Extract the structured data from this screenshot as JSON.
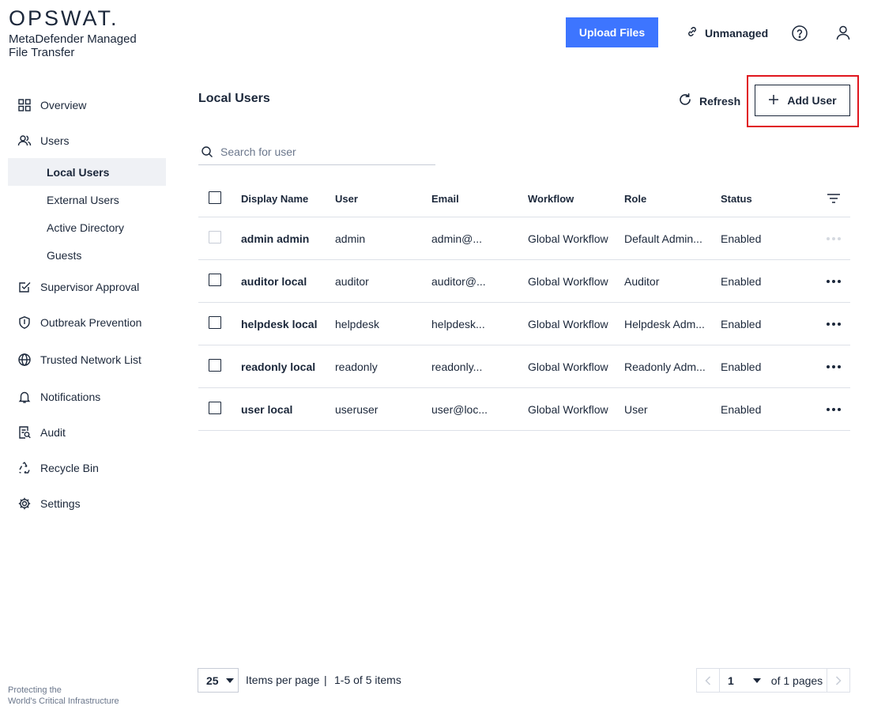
{
  "brand": {
    "wordmark": "OPSWAT.",
    "product_line1": "MetaDefender Managed",
    "product_line2": "File Transfer",
    "footer_line1": "Protecting the",
    "footer_line2": "World's Critical Infrastructure"
  },
  "header": {
    "upload_label": "Upload Files",
    "unmanaged_label": "Unmanaged",
    "help_icon": "help-circle-icon",
    "user_icon": "user-icon"
  },
  "sidebar": {
    "overview": "Overview",
    "users": "Users",
    "users_sub": {
      "local_users": "Local Users",
      "external_users": "External Users",
      "active_directory": "Active Directory",
      "guests": "Guests"
    },
    "supervisor_approval": "Supervisor Approval",
    "outbreak_prevention": "Outbreak Prevention",
    "trusted_network_list": "Trusted Network List",
    "notifications": "Notifications",
    "audit": "Audit",
    "recycle_bin": "Recycle Bin",
    "settings": "Settings"
  },
  "main": {
    "title": "Local Users",
    "refresh_label": "Refresh",
    "add_user_label": "Add User",
    "search_placeholder": "Search for user",
    "accent_color": "#3d75ff",
    "highlight_color": "#e0161e"
  },
  "table": {
    "headers": {
      "display_name": "Display Name",
      "user": "User",
      "email": "Email",
      "workflow": "Workflow",
      "role": "Role",
      "status": "Status"
    },
    "rows": [
      {
        "display_name": "admin admin",
        "user": "admin",
        "email": "admin@...",
        "workflow": "Global Workflow",
        "role": "Default Admin...",
        "status": "Enabled"
      },
      {
        "display_name": "auditor local",
        "user": "auditor",
        "email": "auditor@...",
        "workflow": "Global Workflow",
        "role": "Auditor",
        "status": "Enabled"
      },
      {
        "display_name": "helpdesk local",
        "user": "helpdesk",
        "email": "helpdesk...",
        "workflow": "Global Workflow",
        "role": "Helpdesk Adm...",
        "status": "Enabled"
      },
      {
        "display_name": "readonly local",
        "user": "readonly",
        "email": "readonly...",
        "workflow": "Global Workflow",
        "role": "Readonly Adm...",
        "status": "Enabled"
      },
      {
        "display_name": "user local",
        "user": "useruser",
        "email": "user@loc...",
        "workflow": "Global Workflow",
        "role": "User",
        "status": "Enabled"
      }
    ]
  },
  "pagination": {
    "per_page": "25",
    "per_page_label": "Items per page",
    "separator": "|",
    "range": "1-5 of 5 items",
    "current_page": "1",
    "of_pages": "of 1 pages"
  }
}
